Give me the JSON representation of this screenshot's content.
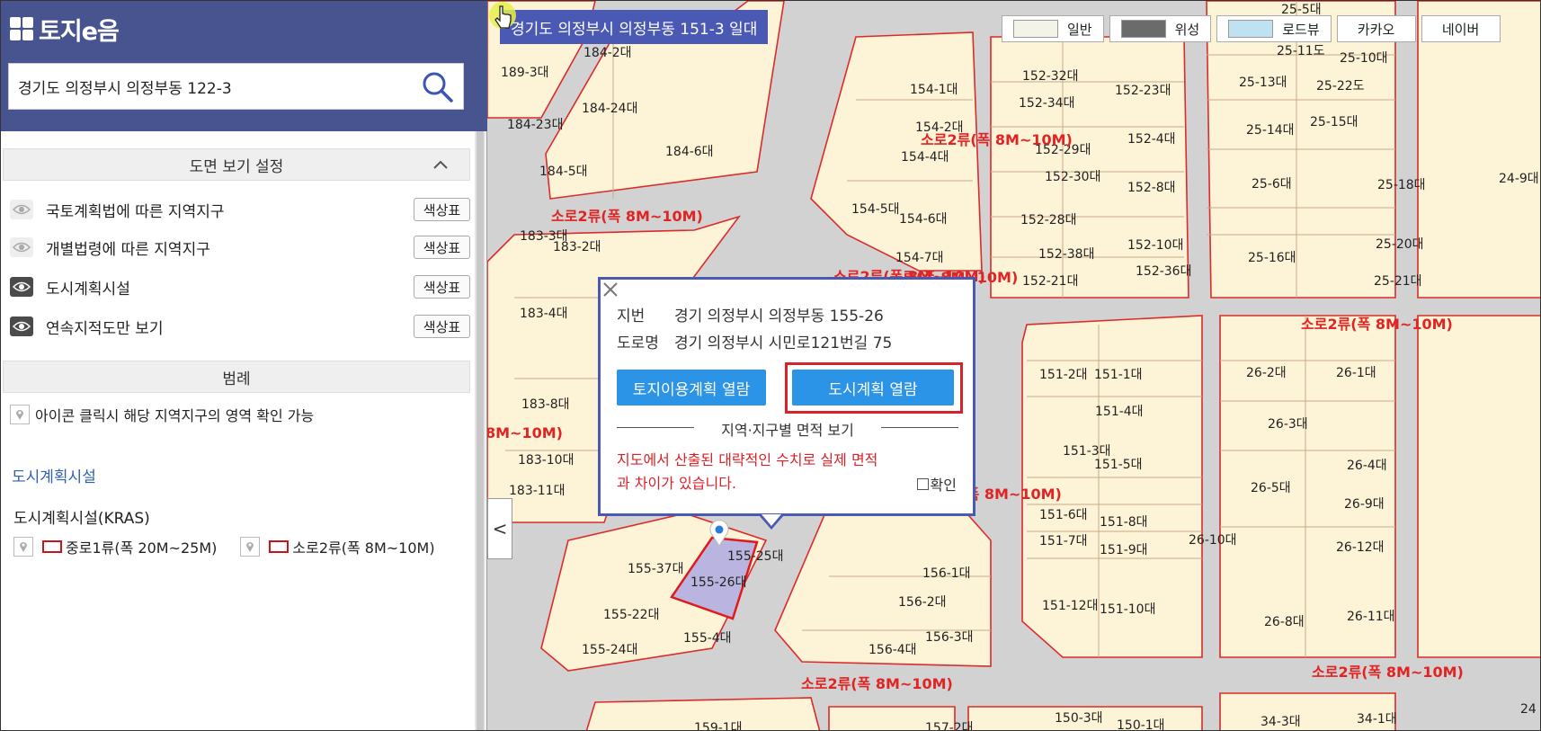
{
  "sidebar": {
    "logo_text": "토지e음",
    "search": {
      "value": "경기도 의정부시 의정부동 122-3"
    },
    "view_settings": {
      "title": "도면 보기 설정"
    },
    "layers": [
      {
        "label": "국토계획법에 따른 지역지구",
        "visible": false,
        "color_button": "색상표"
      },
      {
        "label": "개별법령에 따른 지역지구",
        "visible": false,
        "color_button": "색상표"
      },
      {
        "label": "도시계획시설",
        "visible": true,
        "color_button": "색상표"
      },
      {
        "label": "연속지적도만 보기",
        "visible": true,
        "color_button": "색상표"
      }
    ],
    "legend": {
      "title": "범례",
      "note": "아이콘 클릭시 해당 지역지구의 영역 확인 가능",
      "facility_title": "도시계획시설",
      "kras_title": "도시계획시설(KRAS)",
      "items": [
        {
          "label": "중로1류(폭 20M~25M)",
          "color": "#c8161d"
        },
        {
          "label": "소로2류(폭 8M~10M)",
          "color": "#c8161d"
        }
      ]
    }
  },
  "map": {
    "address_banner": "경기도 의정부시 의정부동 151-3 일대",
    "map_types": [
      "일반",
      "위성",
      "로드뷰",
      "카카오",
      "네이버"
    ],
    "collapse_glyph": "<",
    "colors": {
      "parcel_fill": "#fdf3d6",
      "parcel_border": "#dc2b2b",
      "road": "#d2d2d2",
      "selected_fill": "#b9b4e0",
      "road_label": "#e02424"
    },
    "popup": {
      "jibun_key": "지번",
      "jibun_value": "경기 의정부시 의정부동 155-26",
      "road_key": "도로명",
      "road_value": "경기 의정부시 시민로121번길 75",
      "btn_land": "토지이용계획 열람",
      "btn_city": "도시계획 열람",
      "area_title": "지역·지구별 면적 보기",
      "warning": "지도에서 산출된 대략적인 수치로 실제 면적과 차이가 있습니다.",
      "confirm_label": "확인"
    },
    "parcel_labels": [
      "189-3대",
      "184-2대",
      "184-24대",
      "184-23대",
      "184-6대",
      "184-5대",
      "183-3대",
      "183-2대",
      "183-4대",
      "183-8대",
      "183-10대",
      "183-11대",
      "154-1대",
      "154-2대",
      "154-4대",
      "154-5대",
      "154-6대",
      "154-7대",
      "152-32대",
      "152-34대",
      "152-29대",
      "152-30대",
      "152-28대",
      "152-38대",
      "152-21대",
      "152-23대",
      "152-4대",
      "152-8대",
      "152-10대",
      "152-36대",
      "25-5대",
      "25-11도",
      "25-10대",
      "25-13대",
      "25-22도",
      "25-14대",
      "25-15대",
      "25-6대",
      "25-18대",
      "25-16대",
      "25-20대",
      "25-21대",
      "24-9대",
      "151-2대",
      "151-1대",
      "151-4대",
      "151-3대",
      "151-5대",
      "151-6대",
      "151-7대",
      "151-8대",
      "151-9대",
      "151-12대",
      "151-10대",
      "26-2대",
      "26-1대",
      "26-3대",
      "26-4대",
      "26-5대",
      "26-9대",
      "26-10대",
      "26-12대",
      "26-8대",
      "26-11대",
      "155-37대",
      "155-25대",
      "155-26대",
      "155-22대",
      "155-24대",
      "155-4대",
      "156-1대",
      "156-2대",
      "156-3대",
      "156-4대",
      "159-1대",
      "157-2대",
      "150-3대",
      "150-1대",
      "34-3대",
      "34-1대",
      "24"
    ],
    "road_labels": [
      "소로2류(폭 8M~10M)",
      "소로2류(폭 8M~10M)",
      "소로2류(폭 8M~10M)",
      "소로2류(폭 8M~10M)",
      "소로2류(폭 8M~10M)",
      "소로2류(폭 8M~10M)",
      "소로2류(폭 8M~10M)",
      "8M~10M)",
      "류(폭 8M~10M)"
    ]
  }
}
